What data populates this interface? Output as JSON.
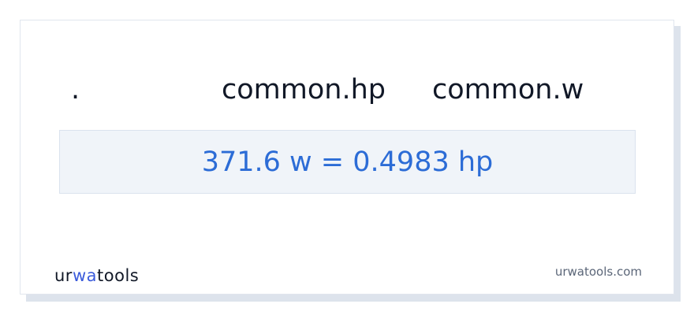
{
  "header": {
    "dot": ".",
    "from_unit": "common.hp",
    "to_unit": "common.w"
  },
  "result": {
    "text": "371.6 w = 0.4983 hp"
  },
  "brand": {
    "logo_text": "urwatools",
    "logo_part1": "ur",
    "logo_part2": "wa",
    "logo_part3": "too",
    "logo_part4": "ls",
    "site": "urwatools.com"
  },
  "colors": {
    "result_text": "#2c6cd6",
    "result_bg": "#f0f4f9",
    "logo_accent": "#3b5bdb"
  }
}
